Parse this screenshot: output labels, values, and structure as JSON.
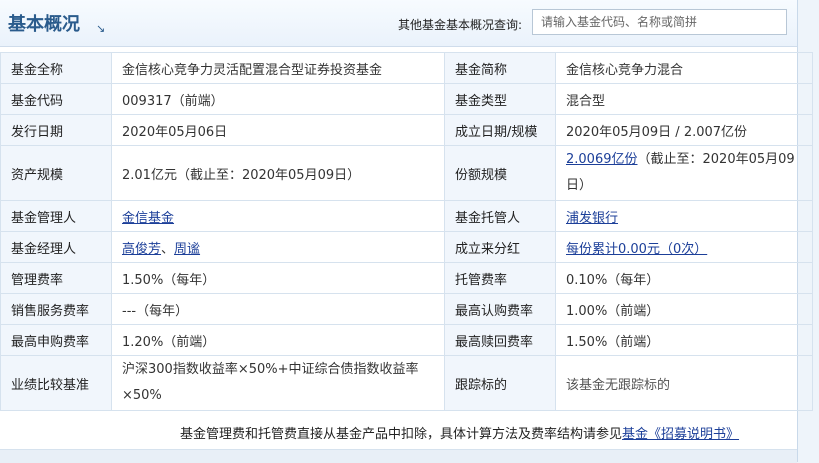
{
  "header": {
    "title": "基本概况",
    "title_arrow": "↘",
    "query_label": "其他基金基本概况查询:",
    "search_placeholder": "请输入基金代码、名称或简拼"
  },
  "rows": [
    {
      "l1": "基金全称",
      "v1": "金信核心竞争力灵活配置混合型证券投资基金",
      "l2": "基金简称",
      "v2": "金信核心竞争力混合"
    },
    {
      "l1": "基金代码",
      "v1": "009317（前端）",
      "l2": "基金类型",
      "v2": "混合型"
    },
    {
      "l1": "发行日期",
      "v1": "2020年05月06日",
      "l2": "成立日期/规模",
      "v2": "2020年05月09日 / 2.007亿份"
    },
    {
      "l1": "资产规模",
      "v1": "2.01亿元（截止至：2020年05月09日）",
      "l2": "份额规模",
      "v2_link": "2.0069亿份",
      "v2_rest": "（截止至：2020年05月09日）"
    },
    {
      "l1": "基金管理人",
      "v1_link": "金信基金",
      "l2": "基金托管人",
      "v2_link": "浦发银行"
    },
    {
      "l1": "基金经理人",
      "v1_link_a": "高俊芳",
      "v1_sep": "、",
      "v1_link_b": "周谧",
      "l2": "成立来分红",
      "v2_link": "每份累计0.00元（0次）"
    },
    {
      "l1": "管理费率",
      "v1": "1.50%（每年）",
      "l2": "托管费率",
      "v2": "0.10%（每年）"
    },
    {
      "l1": "销售服务费率",
      "v1": "---（每年）",
      "l2": "最高认购费率",
      "v2": "1.00%（前端）"
    },
    {
      "l1": "最高申购费率",
      "v1": "1.20%（前端）",
      "l2": "最高赎回费率",
      "v2": "1.50%（前端）"
    },
    {
      "l1": "业绩比较基准",
      "v1": "沪深300指数收益率×50%+中证综合债指数收益率×50%",
      "l2": "跟踪标的",
      "v2": "该基金无跟踪标的"
    }
  ],
  "note": {
    "text": "基金管理费和托管费直接从基金产品中扣除，具体计算方法及费率结构请参见",
    "link": "基金《招募说明书》"
  }
}
